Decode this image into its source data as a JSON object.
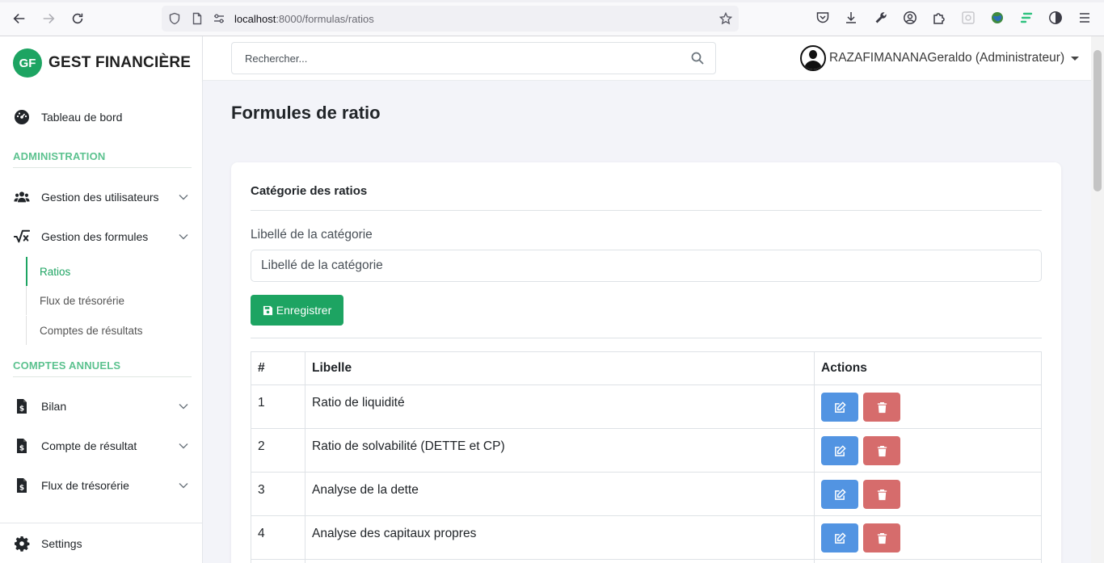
{
  "browser": {
    "url_host": "localhost",
    "url_path": ":8000/formulas/ratios"
  },
  "brand": {
    "logo": "GF",
    "name": "GEST FINANCIÈRE"
  },
  "sidebar": {
    "dashboard": "Tableau de bord",
    "section_admin": "ADMINISTRATION",
    "users": "Gestion des utilisateurs",
    "formulas": "Gestion des formules",
    "formula_sub": [
      "Ratios",
      "Flux de trésorérie",
      "Comptes de résultats"
    ],
    "section_annual": "COMPTES ANNUELS",
    "annual_items": [
      "Bilan",
      "Compte de résultat",
      "Flux de trésorérie"
    ],
    "settings": "Settings"
  },
  "header": {
    "search_placeholder": "Rechercher...",
    "user": "RAZAFIMANANAGeraldo (Administrateur)"
  },
  "main": {
    "title": "Formules de ratio",
    "card_title": "Catégorie des ratios",
    "field_label": "Libellé de la catégorie",
    "field_placeholder": "Libellé de la catégorie",
    "save_label": "Enregistrer",
    "table": {
      "headers": [
        "#",
        "Libelle",
        "Actions"
      ],
      "rows": [
        {
          "num": "1",
          "libelle": "Ratio de liquidité"
        },
        {
          "num": "2",
          "libelle": "Ratio de solvabilité (DETTE et CP)"
        },
        {
          "num": "3",
          "libelle": "Analyse de la dette"
        },
        {
          "num": "4",
          "libelle": "Analyse des capitaux propres"
        }
      ]
    }
  },
  "colors": {
    "brand_green": "#1da462",
    "section_green": "#5cc28f",
    "edit_blue": "#5294e2",
    "delete_red": "#d66c6c"
  }
}
